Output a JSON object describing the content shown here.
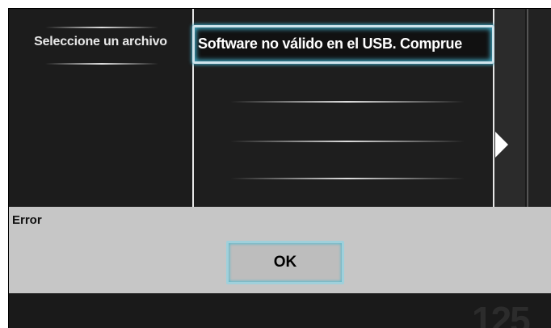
{
  "file_panel": {
    "label": "Seleccione un archivo"
  },
  "file_list": {
    "selected_item": "Software no válido en el USB. Comprue"
  },
  "dialog": {
    "title": "Error",
    "ok_label": "OK"
  },
  "watermark": {
    "text": "125"
  },
  "colors": {
    "focus_accent": "#3da3bd",
    "dialog_bg": "#c6c6c6",
    "screen_bg": "#1a1a1a"
  },
  "icons": {
    "next_arrow": "triangle-right-icon"
  }
}
